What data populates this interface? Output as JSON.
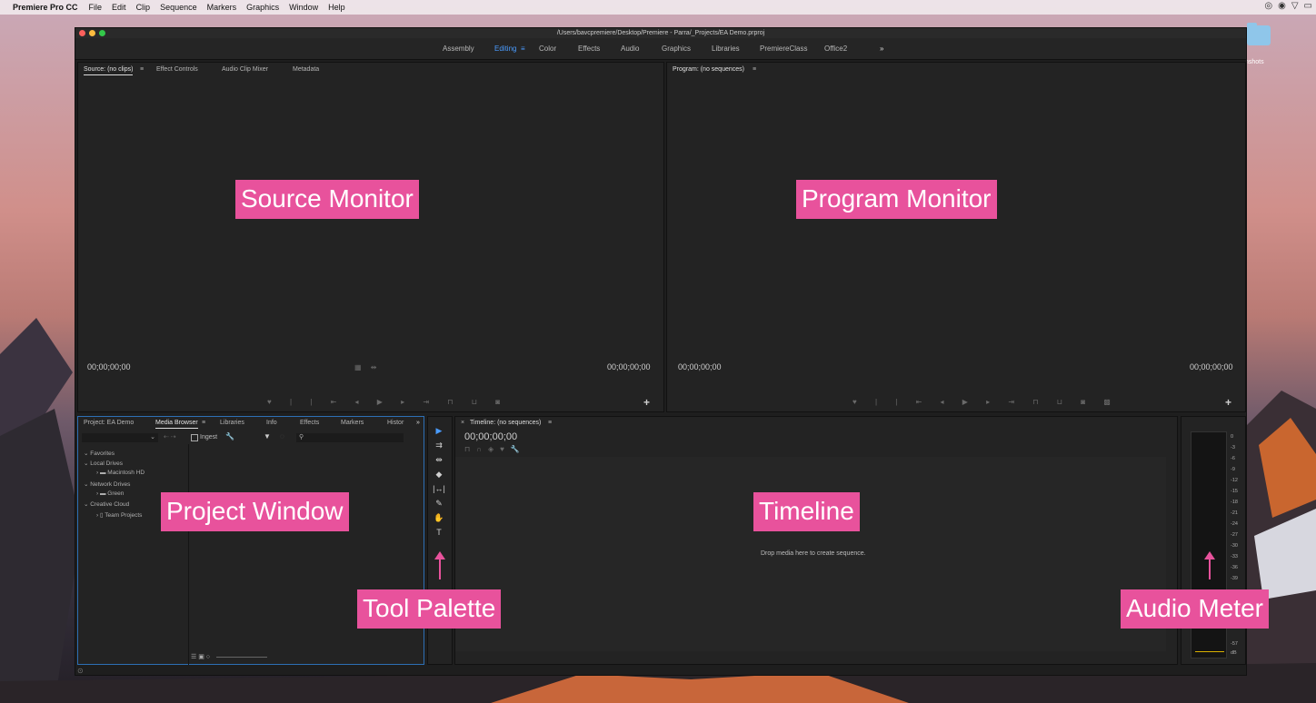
{
  "menubar": {
    "app_name": "Premiere Pro CC",
    "items": [
      "File",
      "Edit",
      "Clip",
      "Sequence",
      "Markers",
      "Graphics",
      "Window",
      "Help"
    ]
  },
  "desktop": {
    "folder_label": "nshots"
  },
  "window": {
    "title": "/Users/bavcpremiere/Desktop/Premiere - Parra/_Projects/EA Demo.prproj",
    "workspaces": [
      "Assembly",
      "Editing",
      "Color",
      "Effects",
      "Audio",
      "Graphics",
      "Libraries",
      "PremiereClass",
      "Office2"
    ],
    "active_workspace": "Editing",
    "more": "»"
  },
  "source_panel": {
    "tabs": [
      "Source: (no clips)",
      "Effect Controls",
      "Audio Clip Mixer",
      "Metadata"
    ],
    "timecode_left": "00;00;00;00",
    "timecode_right": "00;00;00;00"
  },
  "program_panel": {
    "tab": "Program: (no sequences)",
    "timecode_left": "00;00;00;00",
    "timecode_right": "00;00;00;00"
  },
  "project_panel": {
    "tabs": [
      "Project: EA Demo",
      "Media Browser",
      "Libraries",
      "Info",
      "Effects",
      "Markers",
      "Histor"
    ],
    "ingest_label": "Ingest",
    "tree": {
      "favorites": "Favorites",
      "local_drives": "Local Drives",
      "macintosh_hd": "Macintosh HD",
      "network_drives": "Network Drives",
      "green": "Green",
      "creative_cloud": "Creative Cloud",
      "team_projects": "Team Projects"
    }
  },
  "timeline_panel": {
    "tab": "Timeline: (no sequences)",
    "timecode": "00;00;00;00",
    "drop_hint": "Drop media here to create sequence."
  },
  "audio_meter": {
    "scale": [
      "0",
      "-3",
      "-6",
      "-9",
      "-12",
      "-15",
      "-18",
      "-21",
      "-24",
      "-27",
      "-30",
      "-33",
      "-36",
      "-39",
      "-57",
      "dB"
    ]
  },
  "annotations": {
    "source_monitor": "Source Monitor",
    "program_monitor": "Program Monitor",
    "project_window": "Project Window",
    "timeline": "Timeline",
    "tool_palette": "Tool Palette",
    "audio_meter": "Audio Meter"
  },
  "colors": {
    "accent": "#4a9cff",
    "annotation": "#e8529c"
  }
}
